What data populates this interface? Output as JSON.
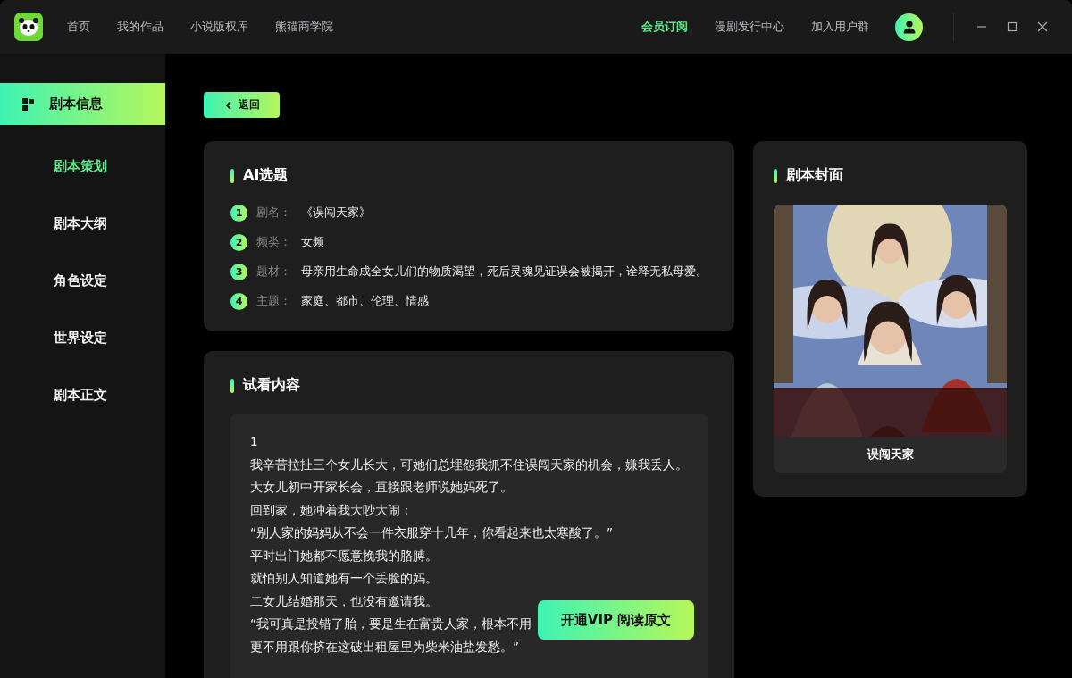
{
  "nav": {
    "left": [
      {
        "label": "首页",
        "selected": false
      },
      {
        "label": "我的作品",
        "selected": false
      },
      {
        "label": "小说版权库",
        "selected": false
      },
      {
        "label": "熊猫商学院",
        "selected": false
      }
    ],
    "right": [
      {
        "label": "会员订阅",
        "selected": true
      },
      {
        "label": "漫剧发行中心",
        "selected": false
      },
      {
        "label": "加入用户群",
        "selected": false
      }
    ]
  },
  "sidebar": {
    "header": {
      "label": "剧本信息",
      "selected": true
    },
    "items": [
      {
        "label": "剧本策划",
        "selected": true
      },
      {
        "label": "剧本大纲",
        "selected": false
      },
      {
        "label": "角色设定",
        "selected": false
      },
      {
        "label": "世界设定",
        "selected": false
      },
      {
        "label": "剧本正文",
        "selected": false
      }
    ]
  },
  "back_button": "返回",
  "topic_card": {
    "title": "AI选题",
    "rows": [
      {
        "index": "1",
        "label": "剧名：",
        "value": "《误闯天家》"
      },
      {
        "index": "2",
        "label": "频类：",
        "value": "女频"
      },
      {
        "index": "3",
        "label": "题材：",
        "value": "母亲用生命成全女儿们的物质渴望，死后灵魂见证误会被揭开，诠释无私母爱。"
      },
      {
        "index": "4",
        "label": "主题：",
        "value": "家庭、都市、伦理、情感"
      }
    ]
  },
  "preview_card": {
    "title": "试看内容",
    "lines": [
      "1",
      "我辛苦拉扯三个女儿长大，可她们总埋怨我抓不住误闯天家的机会，嫌我丢人。",
      "大女儿初中开家长会，直接跟老师说她妈死了。",
      "回到家，她冲着我大吵大闹：",
      "“别人家的妈妈从不会一件衣服穿十几年，你看起来也太寒酸了。”",
      "平时出门她都不愿意挽我的胳膊。",
      "就怕别人知道她有一个丢脸的妈。",
      "二女儿结婚那天，也没有邀请我。",
      "“我可真是投错了胎，要是生在富贵人家，根本不用",
      "更不用跟你挤在这破出租屋里为柴米油盐发愁。”"
    ],
    "vip_button": "开通VIP 阅读原文"
  },
  "cover_card": {
    "title": "剧本封面",
    "caption": "误闯天家"
  }
}
